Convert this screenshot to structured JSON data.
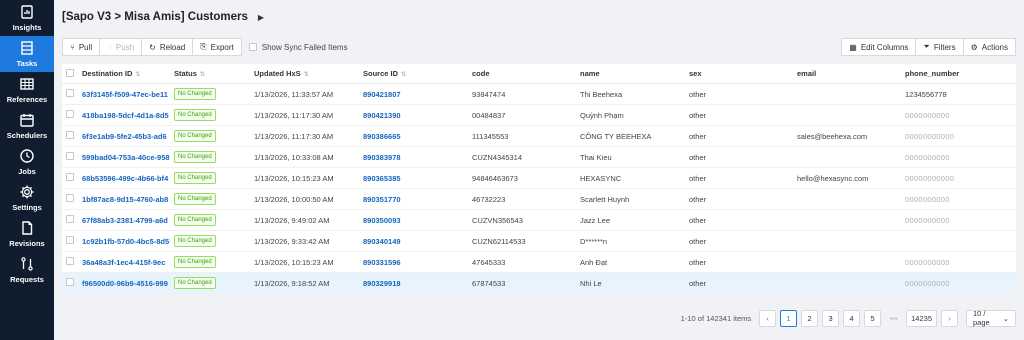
{
  "sidebar": {
    "items": [
      {
        "label": "Insights",
        "icon": "insights-icon",
        "active": false
      },
      {
        "label": "Tasks",
        "icon": "tasks-icon",
        "active": true
      },
      {
        "label": "References",
        "icon": "references-icon",
        "active": false
      },
      {
        "label": "Schedulers",
        "icon": "calendar-icon",
        "active": false
      },
      {
        "label": "Jobs",
        "icon": "clock-icon",
        "active": false
      },
      {
        "label": "Settings",
        "icon": "gear-icon",
        "active": false
      },
      {
        "label": "Revisions",
        "icon": "document-icon",
        "active": false
      },
      {
        "label": "Requests",
        "icon": "git-compare-icon",
        "active": false
      }
    ]
  },
  "header": {
    "title": "[Sapo V3 > Misa Amis] Customers",
    "menu_arrow": "▶"
  },
  "toolbar": {
    "pull_label": "Pull",
    "push_label": "Push",
    "reload_label": "Reload",
    "export_label": "Export",
    "show_failed_label": "Show Sync Failed Items",
    "edit_columns_label": "Edit Columns",
    "filters_label": "Filters",
    "actions_label": "Actions"
  },
  "table": {
    "columns": [
      "Destination ID",
      "Status",
      "Updated HxS",
      "Source ID",
      "code",
      "name",
      "sex",
      "email",
      "phone_number"
    ],
    "rows": [
      {
        "dest_id": "63f3145f-f509-47ec-be11",
        "status": "No Changed",
        "updated": "1/13/2026, 11:33:57 AM",
        "source_id": "890421807",
        "code": "93847474",
        "name": "Thi Beehexa",
        "sex": "other",
        "email": "",
        "phone": "1234556778",
        "phone_masked": false
      },
      {
        "dest_id": "418ba198-5dcf-4d1a-8d5",
        "status": "No Changed",
        "updated": "1/13/2026, 11:17:30 AM",
        "source_id": "890421390",
        "code": "00484837",
        "name": "Quỳnh Phạm",
        "sex": "other",
        "email": "",
        "phone": "0000000000",
        "phone_masked": true
      },
      {
        "dest_id": "6f3e1ab9-5fe2-45b3-ad6",
        "status": "No Changed",
        "updated": "1/13/2026, 11:17:30 AM",
        "source_id": "890386665",
        "code": "111345553",
        "name": "CÔNG TY BEEHEXA",
        "sex": "other",
        "email": "sales@beehexa.com",
        "phone": "00000000000",
        "phone_masked": true
      },
      {
        "dest_id": "599bad04-753a-40ce-958",
        "status": "No Changed",
        "updated": "1/13/2026, 10:33:08 AM",
        "source_id": "890383978",
        "code": "CUZN4345314",
        "name": "Thai Kieu",
        "sex": "other",
        "email": "",
        "phone": "0000000000",
        "phone_masked": true
      },
      {
        "dest_id": "68b53596-499c-4b66-bf4",
        "status": "No Changed",
        "updated": "1/13/2026, 10:15:23 AM",
        "source_id": "890365385",
        "code": "94846463673",
        "name": "HEXASYNC",
        "sex": "other",
        "email": "hello@hexasync.com",
        "phone": "00000000000",
        "phone_masked": true
      },
      {
        "dest_id": "1bf87ac8-9d15-4760-ab8",
        "status": "No Changed",
        "updated": "1/13/2026, 10:00:50 AM",
        "source_id": "890351770",
        "code": "46732223",
        "name": "Scarlett Huynh",
        "sex": "other",
        "email": "",
        "phone": "0000000000",
        "phone_masked": true
      },
      {
        "dest_id": "67f88ab3-2381-4799-a6d",
        "status": "No Changed",
        "updated": "1/13/2026, 9:49:02 AM",
        "source_id": "890350093",
        "code": "CUZVN356543",
        "name": "Jazz Lee",
        "sex": "other",
        "email": "",
        "phone": "0000000000",
        "phone_masked": true
      },
      {
        "dest_id": "1c92b1fb-57d0-4bc5-8d5",
        "status": "No Changed",
        "updated": "1/13/2026, 9:33:42 AM",
        "source_id": "890340149",
        "code": "CUZN62114533",
        "name": "D******n",
        "sex": "other",
        "email": "",
        "phone": "",
        "phone_masked": false
      },
      {
        "dest_id": "36a48a3f-1ec4-415f-9ec",
        "status": "No Changed",
        "updated": "1/13/2026, 10:15:23 AM",
        "source_id": "890331596",
        "code": "47645333",
        "name": "Anh Đạt",
        "sex": "other",
        "email": "",
        "phone": "0000000000",
        "phone_masked": true
      },
      {
        "dest_id": "f96500d0-96b9-4516-999",
        "status": "No Changed",
        "updated": "1/13/2026, 9:18:52 AM",
        "source_id": "890329918",
        "code": "67874533",
        "name": "Nhi Le",
        "sex": "other",
        "email": "",
        "phone": "0000000000",
        "phone_masked": true
      }
    ]
  },
  "pagination": {
    "total": "1-10 of 142341 items",
    "pages": [
      "1",
      "2",
      "3",
      "4",
      "5",
      "•••",
      "14235"
    ],
    "current": "1",
    "page_size": "10 / page"
  },
  "colors": {
    "sidebar_bg": "#0f1d2e",
    "accent": "#1f7ae0",
    "link": "#1565c0",
    "status_green": "#389e0d",
    "row_highlight": "#e8f4fd"
  }
}
